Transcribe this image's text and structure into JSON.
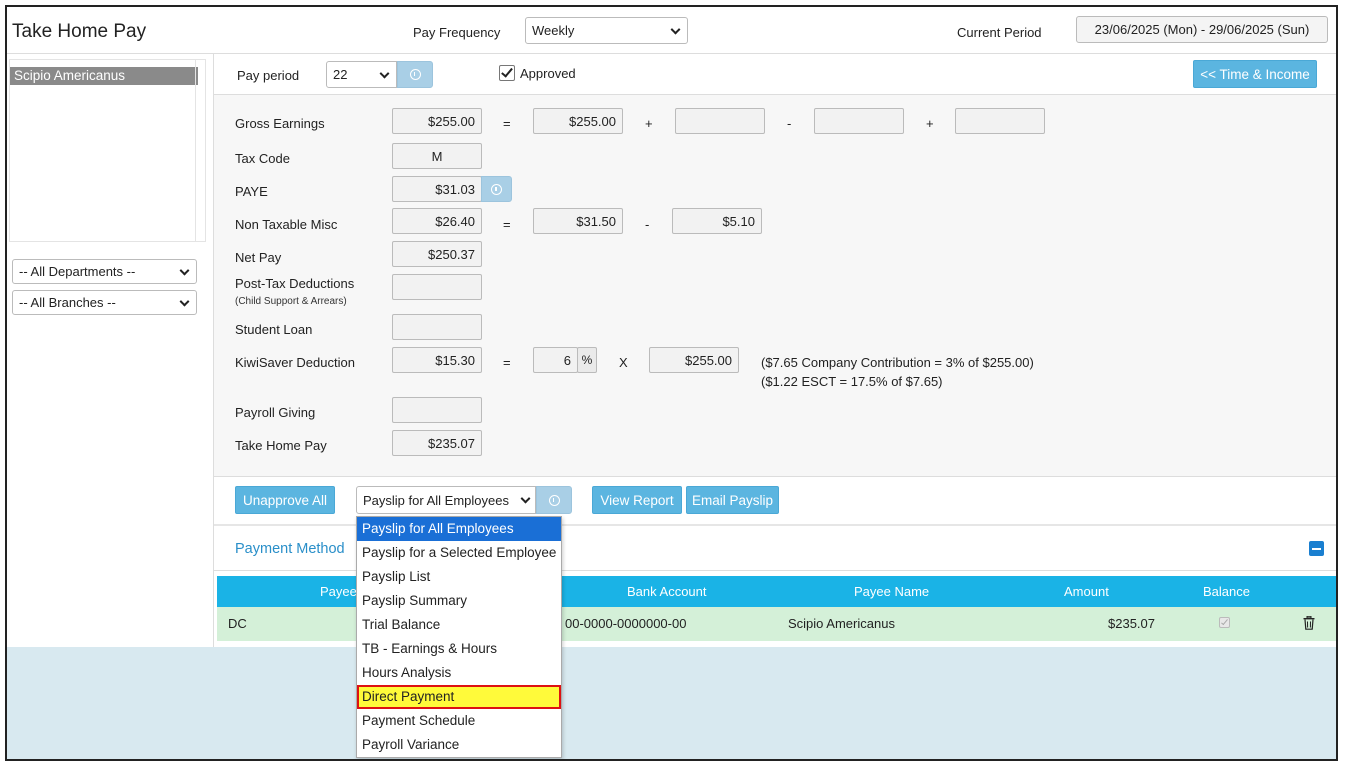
{
  "header": {
    "title": "Take Home Pay",
    "pay_frequency_label": "Pay Frequency",
    "pay_frequency_value": "Weekly",
    "current_period_label": "Current Period",
    "current_period_value": "23/06/2025 (Mon) - 29/06/2025 (Sun)"
  },
  "sidebar": {
    "employees": [
      "Scipio Americanus"
    ],
    "departments": "-- All Departments --",
    "branches": "-- All Branches --"
  },
  "toolbar": {
    "pay_period_label": "Pay period",
    "pay_period_value": "22",
    "approved_label": "Approved",
    "approved_checked": true,
    "time_income_button": "<< Time & Income"
  },
  "form": {
    "gross_earnings": {
      "label": "Gross Earnings",
      "value": "$255.00",
      "eq": "=",
      "v1": "$255.00",
      "plus1": "+",
      "v2": "",
      "minus": "-",
      "v3": "",
      "plus2": "+",
      "v4": ""
    },
    "tax_code": {
      "label": "Tax Code",
      "value": "M"
    },
    "paye": {
      "label": "PAYE",
      "value": "$31.03"
    },
    "non_taxable_misc": {
      "label": "Non Taxable Misc",
      "value": "$26.40",
      "eq": "=",
      "v1": "$31.50",
      "minus": "-",
      "v2": "$5.10"
    },
    "net_pay": {
      "label": "Net Pay",
      "value": "$250.37"
    },
    "post_tax_deductions": {
      "label": "Post-Tax Deductions",
      "sublabel": "(Child Support & Arrears)",
      "value": ""
    },
    "student_loan": {
      "label": "Student Loan",
      "value": ""
    },
    "kiwisaver": {
      "label": "KiwiSaver Deduction",
      "value": "$15.30",
      "eq": "=",
      "percent": "6",
      "percent_sign": "%",
      "times": "X",
      "base": "$255.00",
      "note1": "($7.65 Company Contribution = 3% of $255.00)",
      "note2": "($1.22 ESCT = 17.5% of $7.65)"
    },
    "payroll_giving": {
      "label": "Payroll Giving",
      "value": ""
    },
    "take_home_pay": {
      "label": "Take Home Pay",
      "value": "$235.07"
    }
  },
  "actions": {
    "unapprove_all": "Unapprove All",
    "report_select_value": "Payslip for All Employees",
    "view_report": "View Report",
    "email_payslip": "Email Payslip"
  },
  "report_options": [
    "Payslip for All Employees",
    "Payslip for a Selected Employee",
    "Payslip List",
    "Payslip Summary",
    "Trial Balance",
    "TB - Earnings & Hours",
    "Hours Analysis",
    "Direct Payment",
    "Payment Schedule",
    "Payroll Variance"
  ],
  "payment_method": {
    "title": "Payment Method",
    "headers": {
      "payee": "Payee",
      "bank_account": "Bank Account",
      "payee_name": "Payee Name",
      "amount": "Amount",
      "balance": "Balance"
    },
    "rows": [
      {
        "payee": "DC",
        "bank_account": "00-0000-0000000-00",
        "payee_name": "Scipio Americanus",
        "amount": "$235.07"
      }
    ]
  },
  "colors": {
    "accent": "#5bb5e0",
    "table_header": "#1ab3e6",
    "row_bg": "#d4f0d8",
    "selected_option": "#1a6fd6",
    "highlight": "#fffa3a",
    "bottom_bg": "#d8e9f0"
  }
}
